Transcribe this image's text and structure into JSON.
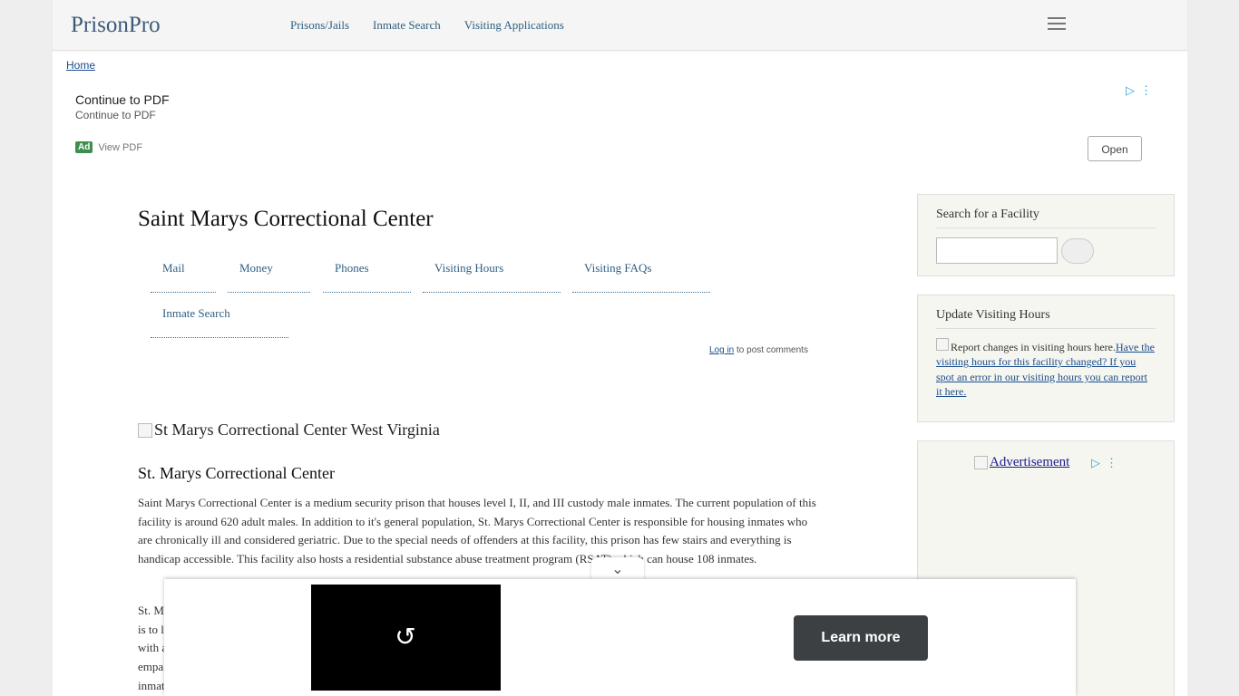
{
  "site": {
    "logo": "PrisonPro"
  },
  "nav": [
    "Prisons/Jails",
    "Inmate Search",
    "Visiting Applications"
  ],
  "breadcrumb": "Home",
  "ad_top": {
    "title": "Continue to PDF",
    "subtitle": "Continue to PDF",
    "badge": "Ad",
    "label": "View PDF",
    "button": "Open"
  },
  "main": {
    "title": "Saint Marys Correctional Center",
    "tabs": [
      "Mail",
      "Money",
      "Phones",
      "Visiting Hours",
      "Visiting FAQs",
      "Inmate Search"
    ],
    "login_link": "Log in",
    "login_suffix": " to post comments",
    "image_alt": "St Marys Correctional Center West Virginia",
    "section_title": "St. Marys Correctional Center",
    "paragraph1": "Saint Marys Correctional Center is a medium security prison that houses level I, II, and III custody male inmates.  The current population of this facility is around 620 adult males.  In addition to it's general population, St. Marys Correctional Center is responsible for housing inmates who are chronically ill and considered geriatric.  Due to the special needs of offenders at this facility, this prison has few stairs and everything is handicap accessible.  This facility also hosts a residential substance abuse treatment program (RSAT) which can house 108 inmates.",
    "paragraph2_fragments": [
      "St. M",
      "is to l",
      "with a",
      "empa",
      "inmat"
    ]
  },
  "sidebar": {
    "search_title": "Search for a Facility",
    "update_title": "Update Visiting Hours",
    "update_img_alt": "Report changes in visiting hours here.",
    "update_link": "Have the visiting hours for this facility changed?  If you spot an error in our visiting hours you can report it here.",
    "advertisement": "Advertisement"
  },
  "video_ad": {
    "button": "Learn more"
  },
  "icons": {
    "menu": "hamburger-icon",
    "replay": "replay-icon",
    "collapse": "chevron-down-icon",
    "adchoices": "adchoices-icon"
  }
}
